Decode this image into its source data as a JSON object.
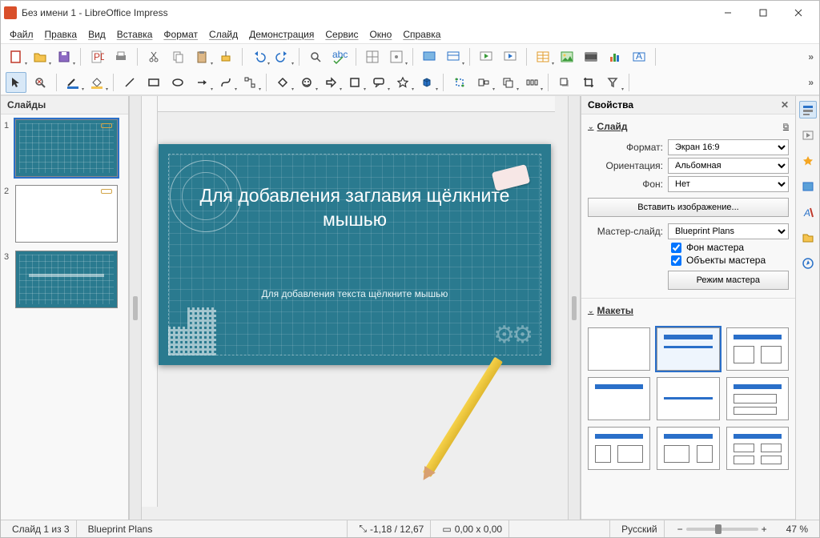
{
  "window": {
    "title": "Без имени 1 - LibreOffice Impress"
  },
  "menu": {
    "file": "Файл",
    "edit": "Правка",
    "view": "Вид",
    "insert": "Вставка",
    "format": "Формат",
    "slide": "Слайд",
    "slideshow": "Демонстрация",
    "tools": "Сервис",
    "window": "Окно",
    "help": "Справка"
  },
  "panels": {
    "slides_title": "Слайды",
    "properties_title": "Свойства"
  },
  "slides": [
    {
      "n": "1",
      "blueprint": true
    },
    {
      "n": "2",
      "blueprint": false
    },
    {
      "n": "3",
      "blueprint": true
    }
  ],
  "canvas": {
    "title_placeholder": "Для добавления заглавия щёлкните мышью",
    "body_placeholder": "Для добавления текста щёлкните мышью"
  },
  "props": {
    "section_slide": "Слайд",
    "format_label": "Формат:",
    "format_value": "Экран 16:9",
    "orientation_label": "Ориентация:",
    "orientation_value": "Альбомная",
    "background_label": "Фон:",
    "background_value": "Нет",
    "insert_image_btn": "Вставить изображение...",
    "master_label": "Мастер-слайд:",
    "master_value": "Blueprint Plans",
    "chk_master_bg": "Фон мастера",
    "chk_master_obj": "Объекты мастера",
    "master_mode_btn": "Режим мастера",
    "section_layouts": "Макеты"
  },
  "status": {
    "slide_counter": "Слайд 1 из 3",
    "master_name": "Blueprint Plans",
    "pos": "-1,18 / 12,67",
    "size": "0,00 x 0,00",
    "lang": "Русский",
    "zoom": "47 %"
  }
}
